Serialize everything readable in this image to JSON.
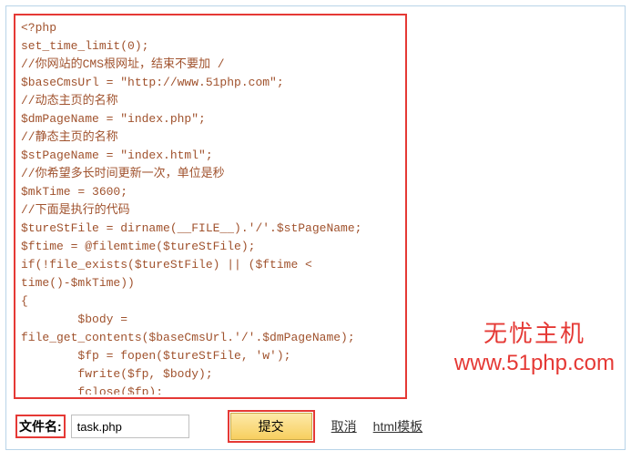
{
  "code": "<?php\nset_time_limit(0);\n//你网站的CMS根网址，结束不要加 /\n$baseCmsUrl = \"http://www.51php.com\";\n//动态主页的名称\n$dmPageName = \"index.php\";\n//静态主页的名称\n$stPageName = \"index.html\";\n//你希望多长时间更新一次，单位是秒\n$mkTime = 3600;\n//下面是执行的代码\n$tureStFile = dirname(__FILE__).'/'.$stPageName;\n$ftime = @filemtime($tureStFile);\nif(!file_exists($tureStFile) || ($ftime < time()-$mkTime))\n{\n        $body = file_get_contents($baseCmsUrl.'/'.$dmPageName);\n        $fp = fopen($tureStFile, 'w');\n        fwrite($fp, $body);\n        fclose($fp);\n}\n?>",
  "form": {
    "filename_label": "文件名:",
    "filename_value": "task.php",
    "submit_label": "提交",
    "cancel_label": "取消",
    "template_label": "html模板"
  },
  "watermark": {
    "title": "无忧主机",
    "url": "www.51php.com"
  }
}
